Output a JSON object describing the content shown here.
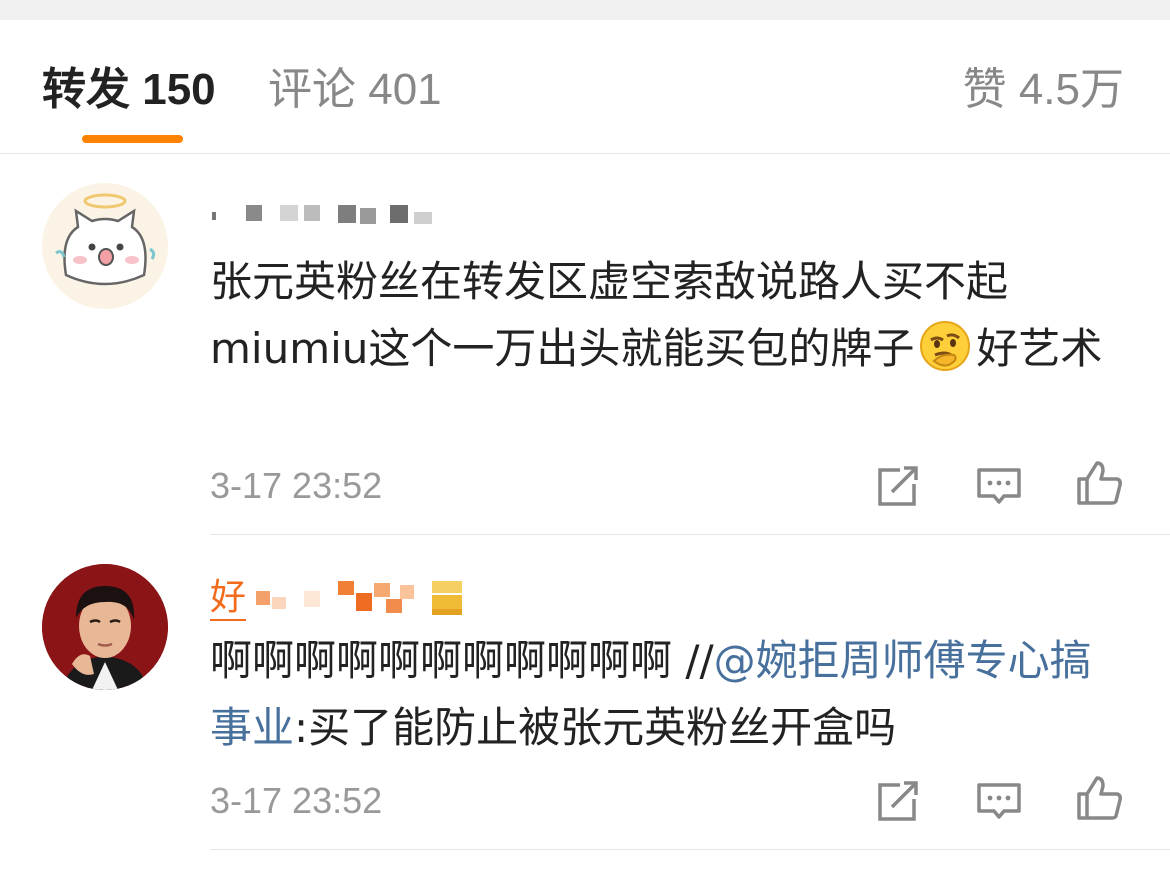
{
  "tabs": {
    "repost_label": "转发",
    "repost_count": "150",
    "comment_label": "评论",
    "comment_count": "401",
    "likes_label": "赞",
    "likes_count": "4.5万",
    "active_color": "#ff8200"
  },
  "items": [
    {
      "avatar_icon": "cat-angel-avatar",
      "content_before": "张元英粉丝在转发区虚空索敌说路人买不起miumiu这个一万出头就能买包的牌子",
      "emoji": "thinking-emoji",
      "content_after": "好艺术",
      "time": "3-17 23:52",
      "actions": [
        "repost-icon",
        "comment-icon",
        "like-icon"
      ]
    },
    {
      "avatar_icon": "cartoon-boy-avatar",
      "username_visible_char": "好",
      "content_main": "啊啊啊啊啊啊啊啊啊啊啊 //",
      "mention": "@婉拒周师傅专心搞事业",
      "content_rest": ":买了能防止被张元英粉丝开盒吗",
      "time": "3-17 23:52",
      "actions": [
        "repost-icon",
        "comment-icon",
        "like-icon"
      ]
    }
  ],
  "colors": {
    "mention": "#48709d",
    "meta_text": "#999999",
    "username_orange": "#f26b1d"
  }
}
